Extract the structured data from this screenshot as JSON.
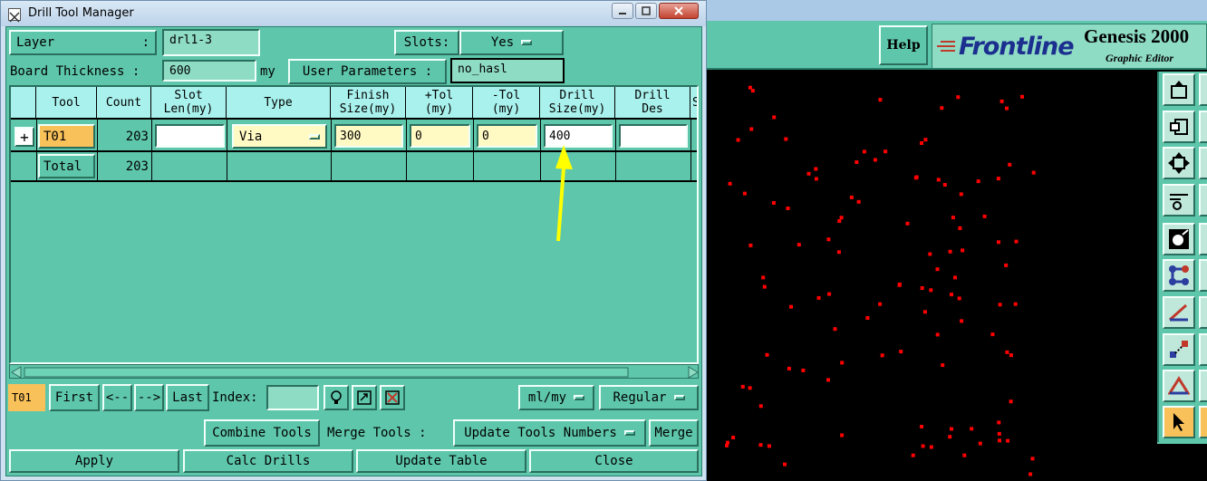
{
  "window": {
    "title": "Drill Tool Manager",
    "minimize_icon": "minimize-icon",
    "maximize_icon": "maximize-icon",
    "close_icon": "close-icon"
  },
  "layer": {
    "label": "Layer",
    "sep": ":",
    "value": "drl1-3"
  },
  "slots": {
    "label": "Slots:",
    "value": "Yes"
  },
  "board_thickness": {
    "label": "Board Thickness :",
    "value": "600",
    "unit": "my"
  },
  "user_parameters": {
    "label": "User Parameters :",
    "value": "no_hasl"
  },
  "table": {
    "headers": [
      {
        "line1": "Tool",
        "line2": ""
      },
      {
        "line1": "Count",
        "line2": ""
      },
      {
        "line1": "Slot",
        "line2": "Len(my)"
      },
      {
        "line1": "Type",
        "line2": ""
      },
      {
        "line1": "Finish",
        "line2": "Size(my)"
      },
      {
        "line1": "+Tol",
        "line2": "(my)"
      },
      {
        "line1": "-Tol",
        "line2": "(my)"
      },
      {
        "line1": "Drill",
        "line2": "Size(my)"
      },
      {
        "line1": "Drill",
        "line2": "Des"
      },
      {
        "line1": "S",
        "line2": ""
      }
    ],
    "rows": [
      {
        "expand": "+",
        "tool": "T01",
        "count": "203",
        "slot_len": "",
        "type": "Via",
        "finish_size": "300",
        "plus_tol": "0",
        "minus_tol": "0",
        "drill_size": "400",
        "drill_des": ""
      }
    ],
    "total": {
      "label": "Total",
      "count": "203"
    }
  },
  "navigation": {
    "current_tool": "T01",
    "first": "First",
    "prev": "<--",
    "next": "-->",
    "last": "Last",
    "index_label": "Index:",
    "index_value": "",
    "units": "ml/my",
    "mode": "Regular"
  },
  "actions": {
    "combine_tools": "Combine Tools",
    "merge_tools_label": "Merge Tools :",
    "merge_option": "Update Tools Numbers",
    "merge": "Merge",
    "apply": "Apply",
    "calc_drills": "Calc Drills",
    "update_table": "Update Table",
    "close": "Close"
  },
  "editor": {
    "help": "Help",
    "logo_text": "Frontline",
    "product_title": "Genesis 2000",
    "product_subtitle": "Graphic Editor"
  },
  "colors": {
    "panel": "#5ec7ab",
    "header_cell": "#a8f1ec",
    "highlight": "#f8c15a",
    "input_yellow": "#fff9c4",
    "drill_dots": "#ff0000",
    "annotation_arrow": "#ffff00"
  }
}
